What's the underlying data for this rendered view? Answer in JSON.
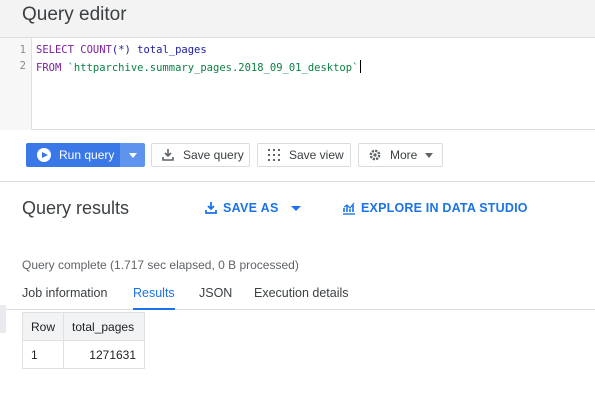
{
  "header": {
    "title": "Query editor"
  },
  "editor": {
    "lines": [
      {
        "number": "1",
        "segments": [
          {
            "text": "SELECT ",
            "kind": "kw"
          },
          {
            "text": "COUNT",
            "kind": "kw"
          },
          {
            "text": "(*) total_pages",
            "kind": "id"
          }
        ]
      },
      {
        "number": "2",
        "segments": [
          {
            "text": "FROM ",
            "kind": "kw"
          },
          {
            "text": "`httparchive.summary_pages.2018_09_01_desktop`",
            "kind": "str"
          }
        ]
      }
    ]
  },
  "toolbar": {
    "run_label": "Run query",
    "save_query_label": "Save query",
    "save_view_label": "Save view",
    "more_label": "More"
  },
  "results": {
    "title": "Query results",
    "save_as_label": "SAVE AS",
    "explore_label": "EXPLORE IN DATA STUDIO",
    "status": "Query complete (1.717 sec elapsed, 0 B processed)",
    "tabs": [
      "Job information",
      "Results",
      "JSON",
      "Execution details"
    ],
    "active_tab": "Results",
    "table": {
      "columns": [
        "Row",
        "total_pages"
      ],
      "rows": [
        [
          "1",
          "1271631"
        ]
      ]
    }
  },
  "colors": {
    "accent": "#1a73e8",
    "run_button": "#3b78e7"
  }
}
